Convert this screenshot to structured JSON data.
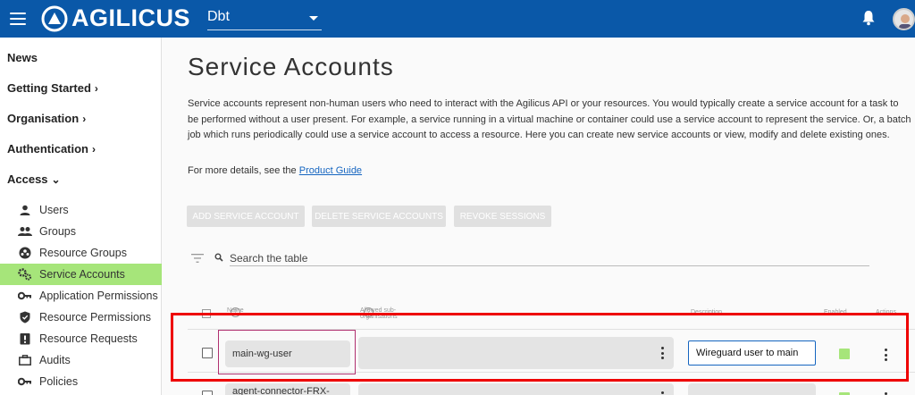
{
  "topbar": {
    "brand": "AGILICUS",
    "org_selected": "Dbt"
  },
  "sidebar": {
    "top_items": [
      {
        "label": "News",
        "chevron": ""
      },
      {
        "label": "Getting Started",
        "chevron": "›"
      },
      {
        "label": "Organisation",
        "chevron": "›"
      },
      {
        "label": "Authentication",
        "chevron": "›"
      },
      {
        "label": "Access",
        "chevron": "⌄"
      }
    ],
    "sub_items": [
      {
        "label": "Users",
        "icon": "person-icon"
      },
      {
        "label": "Groups",
        "icon": "group-icon"
      },
      {
        "label": "Resource Groups",
        "icon": "resource-groups-icon"
      },
      {
        "label": "Service Accounts",
        "icon": "gears-icon"
      },
      {
        "label": "Application Permissions",
        "icon": "key-icon"
      },
      {
        "label": "Resource Permissions",
        "icon": "shield-icon"
      },
      {
        "label": "Resource Requests",
        "icon": "request-icon"
      },
      {
        "label": "Audits",
        "icon": "briefcase-icon"
      },
      {
        "label": "Policies",
        "icon": "key-icon"
      }
    ]
  },
  "main": {
    "title": "Service Accounts",
    "description": "Service accounts represent non-human users who need to interact with the Agilicus API or your resources. You would typically create a service account for a task to be performed without a user present. For example, a service running in a virtual machine or container could use a service account to represent the service. Or, a batch job which runs periodically could use a service account to access a resource. Here you can create new service accounts or view, modify and delete existing ones.",
    "more_prefix": "For more details, see the ",
    "more_link": "Product Guide",
    "buttons": {
      "add": "ADD SERVICE ACCOUNT",
      "delete": "DELETE SERVICE ACCOUNTS",
      "revoke": "REVOKE SESSIONS"
    },
    "search_placeholder": "Search the table",
    "table": {
      "headers": {
        "name": "Name",
        "allowed_sub_orgs": "Allowed sub-organisations",
        "description": "Description",
        "enabled": "Enabled",
        "actions": "Actions"
      },
      "rows": [
        {
          "name": "main-wg-user",
          "description": "Wireguard user to main",
          "enabled": true
        },
        {
          "name": "agent-connector-FRX-servic",
          "description": "",
          "enabled": true
        }
      ]
    }
  },
  "colors": {
    "topbar": "#0a58a8",
    "active_nav": "#a6e57a",
    "highlight": "#ee0000",
    "name_highlight": "#b03070"
  }
}
